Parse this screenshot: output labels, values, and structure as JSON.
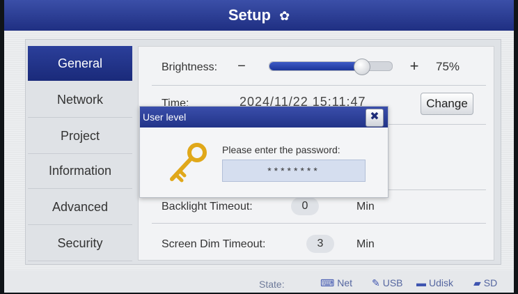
{
  "window": {
    "title": "Setup"
  },
  "sidebar": {
    "items": [
      {
        "label": "General",
        "active": true
      },
      {
        "label": "Network",
        "active": false
      },
      {
        "label": "Project",
        "active": false
      },
      {
        "label": "Information",
        "active": false
      },
      {
        "label": "Advanced",
        "active": false
      },
      {
        "label": "Security",
        "active": false
      }
    ]
  },
  "general": {
    "brightness": {
      "label": "Brightness:",
      "minus": "−",
      "plus": "+",
      "value_text": "75%",
      "level": 0.75
    },
    "time": {
      "label": "Time:",
      "value": "2024/11/22  15:11:47",
      "change_label": "Change"
    },
    "backlight": {
      "label": "Backlight Timeout:",
      "value": "0",
      "unit": "Min"
    },
    "screen_dim": {
      "label": "Screen Dim Timeout:",
      "value": "3",
      "unit": "Min"
    }
  },
  "dialog": {
    "title": "User level",
    "close_icon": "close-icon",
    "icon": "key-icon",
    "prompt": "Please enter the password:",
    "password": "********"
  },
  "statusbar": {
    "state_label": "State:",
    "items": [
      {
        "label": "Net",
        "icon": "network-icon"
      },
      {
        "label": "USB",
        "icon": "usb-icon"
      },
      {
        "label": "Udisk",
        "icon": "udisk-icon"
      },
      {
        "label": "SD",
        "icon": "sd-card-icon"
      }
    ]
  },
  "colors": {
    "accent": "#2b3f9a",
    "key": "#e0a81a"
  }
}
